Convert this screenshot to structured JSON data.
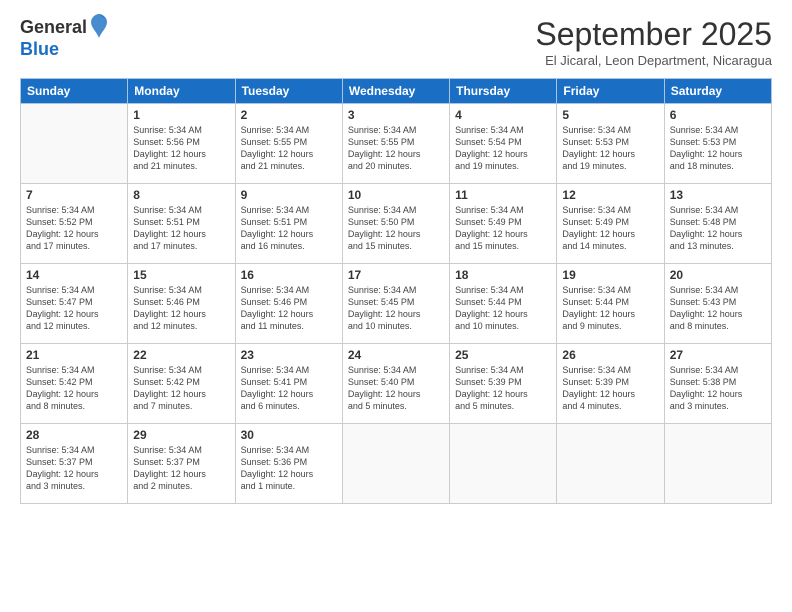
{
  "header": {
    "logo_general": "General",
    "logo_blue": "Blue",
    "month_title": "September 2025",
    "subtitle": "El Jicaral, Leon Department, Nicaragua"
  },
  "days_of_week": [
    "Sunday",
    "Monday",
    "Tuesday",
    "Wednesday",
    "Thursday",
    "Friday",
    "Saturday"
  ],
  "weeks": [
    [
      {
        "day": "",
        "text": ""
      },
      {
        "day": "1",
        "text": "Sunrise: 5:34 AM\nSunset: 5:56 PM\nDaylight: 12 hours\nand 21 minutes."
      },
      {
        "day": "2",
        "text": "Sunrise: 5:34 AM\nSunset: 5:55 PM\nDaylight: 12 hours\nand 21 minutes."
      },
      {
        "day": "3",
        "text": "Sunrise: 5:34 AM\nSunset: 5:55 PM\nDaylight: 12 hours\nand 20 minutes."
      },
      {
        "day": "4",
        "text": "Sunrise: 5:34 AM\nSunset: 5:54 PM\nDaylight: 12 hours\nand 19 minutes."
      },
      {
        "day": "5",
        "text": "Sunrise: 5:34 AM\nSunset: 5:53 PM\nDaylight: 12 hours\nand 19 minutes."
      },
      {
        "day": "6",
        "text": "Sunrise: 5:34 AM\nSunset: 5:53 PM\nDaylight: 12 hours\nand 18 minutes."
      }
    ],
    [
      {
        "day": "7",
        "text": "Sunrise: 5:34 AM\nSunset: 5:52 PM\nDaylight: 12 hours\nand 17 minutes."
      },
      {
        "day": "8",
        "text": "Sunrise: 5:34 AM\nSunset: 5:51 PM\nDaylight: 12 hours\nand 17 minutes."
      },
      {
        "day": "9",
        "text": "Sunrise: 5:34 AM\nSunset: 5:51 PM\nDaylight: 12 hours\nand 16 minutes."
      },
      {
        "day": "10",
        "text": "Sunrise: 5:34 AM\nSunset: 5:50 PM\nDaylight: 12 hours\nand 15 minutes."
      },
      {
        "day": "11",
        "text": "Sunrise: 5:34 AM\nSunset: 5:49 PM\nDaylight: 12 hours\nand 15 minutes."
      },
      {
        "day": "12",
        "text": "Sunrise: 5:34 AM\nSunset: 5:49 PM\nDaylight: 12 hours\nand 14 minutes."
      },
      {
        "day": "13",
        "text": "Sunrise: 5:34 AM\nSunset: 5:48 PM\nDaylight: 12 hours\nand 13 minutes."
      }
    ],
    [
      {
        "day": "14",
        "text": "Sunrise: 5:34 AM\nSunset: 5:47 PM\nDaylight: 12 hours\nand 12 minutes."
      },
      {
        "day": "15",
        "text": "Sunrise: 5:34 AM\nSunset: 5:46 PM\nDaylight: 12 hours\nand 12 minutes."
      },
      {
        "day": "16",
        "text": "Sunrise: 5:34 AM\nSunset: 5:46 PM\nDaylight: 12 hours\nand 11 minutes."
      },
      {
        "day": "17",
        "text": "Sunrise: 5:34 AM\nSunset: 5:45 PM\nDaylight: 12 hours\nand 10 minutes."
      },
      {
        "day": "18",
        "text": "Sunrise: 5:34 AM\nSunset: 5:44 PM\nDaylight: 12 hours\nand 10 minutes."
      },
      {
        "day": "19",
        "text": "Sunrise: 5:34 AM\nSunset: 5:44 PM\nDaylight: 12 hours\nand 9 minutes."
      },
      {
        "day": "20",
        "text": "Sunrise: 5:34 AM\nSunset: 5:43 PM\nDaylight: 12 hours\nand 8 minutes."
      }
    ],
    [
      {
        "day": "21",
        "text": "Sunrise: 5:34 AM\nSunset: 5:42 PM\nDaylight: 12 hours\nand 8 minutes."
      },
      {
        "day": "22",
        "text": "Sunrise: 5:34 AM\nSunset: 5:42 PM\nDaylight: 12 hours\nand 7 minutes."
      },
      {
        "day": "23",
        "text": "Sunrise: 5:34 AM\nSunset: 5:41 PM\nDaylight: 12 hours\nand 6 minutes."
      },
      {
        "day": "24",
        "text": "Sunrise: 5:34 AM\nSunset: 5:40 PM\nDaylight: 12 hours\nand 5 minutes."
      },
      {
        "day": "25",
        "text": "Sunrise: 5:34 AM\nSunset: 5:39 PM\nDaylight: 12 hours\nand 5 minutes."
      },
      {
        "day": "26",
        "text": "Sunrise: 5:34 AM\nSunset: 5:39 PM\nDaylight: 12 hours\nand 4 minutes."
      },
      {
        "day": "27",
        "text": "Sunrise: 5:34 AM\nSunset: 5:38 PM\nDaylight: 12 hours\nand 3 minutes."
      }
    ],
    [
      {
        "day": "28",
        "text": "Sunrise: 5:34 AM\nSunset: 5:37 PM\nDaylight: 12 hours\nand 3 minutes."
      },
      {
        "day": "29",
        "text": "Sunrise: 5:34 AM\nSunset: 5:37 PM\nDaylight: 12 hours\nand 2 minutes."
      },
      {
        "day": "30",
        "text": "Sunrise: 5:34 AM\nSunset: 5:36 PM\nDaylight: 12 hours\nand 1 minute."
      },
      {
        "day": "",
        "text": ""
      },
      {
        "day": "",
        "text": ""
      },
      {
        "day": "",
        "text": ""
      },
      {
        "day": "",
        "text": ""
      }
    ]
  ]
}
